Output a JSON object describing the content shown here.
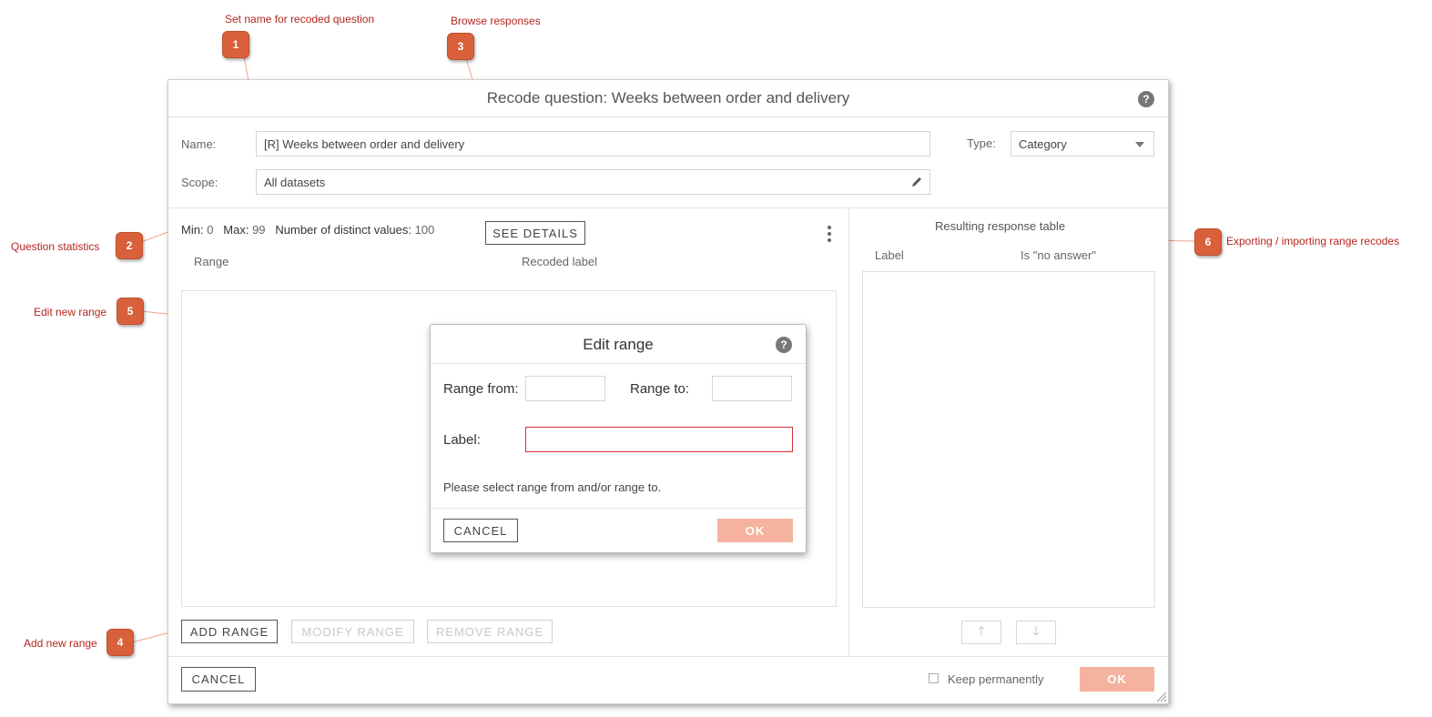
{
  "annotations": {
    "a1": {
      "number": "1",
      "text": "Set name for recoded question"
    },
    "a2": {
      "number": "2",
      "text": "Question statistics"
    },
    "a3": {
      "number": "3",
      "text": "Browse responses"
    },
    "a4": {
      "number": "4",
      "text": "Add new range"
    },
    "a5": {
      "number": "5",
      "text": "Edit new range"
    },
    "a6": {
      "number": "6",
      "text": "Exporting / importing range recodes"
    }
  },
  "dialog": {
    "title": "Recode question: Weeks between order and delivery",
    "help_symbol": "?",
    "name_label": "Name:",
    "name_value": "[R] Weeks between order and delivery",
    "scope_label": "Scope:",
    "scope_value": "All datasets",
    "type_label": "Type:",
    "type_value": "Category",
    "stats": {
      "min_label": "Min:",
      "min_value": "0",
      "max_label": "Max:",
      "max_value": "99",
      "distinct_label": "Number of distinct values:",
      "distinct_value": "100"
    },
    "see_details_button": "SEE DETAILS",
    "columns": {
      "range": "Range",
      "recoded_label": "Recoded label"
    },
    "buttons": {
      "add_range": "ADD RANGE",
      "modify_range": "MODIFY RANGE",
      "remove_range": "REMOVE RANGE",
      "cancel": "CANCEL",
      "ok": "OK"
    },
    "right_panel": {
      "title": "Resulting response table",
      "col_label": "Label",
      "col_no_answer": "Is \"no answer\"",
      "up_arrow": "🡑",
      "down_arrow": "🡓"
    },
    "keep_permanently": {
      "label": "Keep permanently",
      "checked": false
    }
  },
  "edit_range_modal": {
    "title": "Edit range",
    "help_symbol": "?",
    "range_from_label": "Range from:",
    "range_to_label": "Range to:",
    "label_label": "Label:",
    "message": "Please select range from and/or range to.",
    "cancel": "CANCEL",
    "ok": "OK"
  },
  "colors": {
    "badge": "#d8603a",
    "annotation_text": "#b3261e",
    "ok_button": "#f4b29f",
    "error_border": "#d32f2f"
  },
  "icons": [
    "help-icon",
    "pencil-icon",
    "chevron-down-icon",
    "kebab-menu-icon",
    "arrow-up-icon",
    "arrow-down-icon",
    "resize-grip-icon"
  ]
}
